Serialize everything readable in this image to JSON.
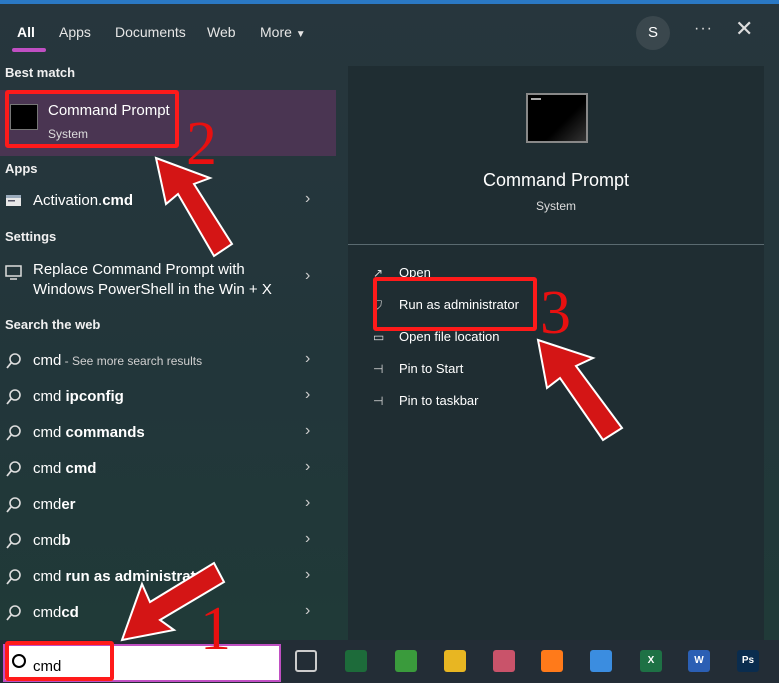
{
  "tabs": [
    {
      "label": "All",
      "active": true
    },
    {
      "label": "Apps"
    },
    {
      "label": "Documents"
    },
    {
      "label": "Web"
    },
    {
      "label": "More"
    }
  ],
  "account_initial": "S",
  "more_options": "···",
  "close_glyph": "✕",
  "sections": {
    "best_match": "Best match",
    "apps": "Apps",
    "settings": "Settings",
    "search_web": "Search the web"
  },
  "best_match": {
    "title": "Command Prompt",
    "subtitle": "System",
    "icon": "cmd-window-icon"
  },
  "apps_items": [
    {
      "name_plain": "Activation.",
      "name_bold": "cmd",
      "icon": "script-file-icon"
    }
  ],
  "settings_items": [
    {
      "line1": "Replace Command Prompt with",
      "line2": "Windows PowerShell in the Win + X",
      "icon": "monitor-icon"
    }
  ],
  "web_items": [
    {
      "plain": "cmd",
      "bold": "",
      "extra": " - See more search results"
    },
    {
      "plain": "cmd ",
      "bold": "ipconfig",
      "extra": ""
    },
    {
      "plain": "cmd ",
      "bold": "commands",
      "extra": ""
    },
    {
      "plain": "cmd ",
      "bold": "cmd",
      "extra": ""
    },
    {
      "plain": "cmd",
      "bold": "er",
      "extra": ""
    },
    {
      "plain": "cmd",
      "bold": "b",
      "extra": ""
    },
    {
      "plain": "cmd ",
      "bold": "run as administrato",
      "extra": ""
    },
    {
      "plain": "cmd",
      "bold": "cd",
      "extra": ""
    }
  ],
  "preview": {
    "title": "Command Prompt",
    "subtitle": "System",
    "actions": [
      {
        "label": "Open",
        "icon": "open-icon"
      },
      {
        "label": "Run as administrator",
        "icon": "shield-icon"
      },
      {
        "label": "Open file location",
        "icon": "folder-icon"
      },
      {
        "label": "Pin to Start",
        "icon": "pin-icon"
      },
      {
        "label": "Pin to taskbar",
        "icon": "pin-icon"
      }
    ]
  },
  "search": {
    "value": "cmd"
  },
  "annotations": {
    "step1": "1",
    "step2": "2",
    "step3": "3",
    "color": "#ff1a1a"
  },
  "taskbar_apps": [
    {
      "name": "task-view-icon",
      "label": "",
      "color": "#232d36"
    },
    {
      "name": "xbox-app-icon",
      "label": "",
      "color": "#1d6b3a"
    },
    {
      "name": "security-lock-icon",
      "label": "",
      "color": "#3a9b3c"
    },
    {
      "name": "file-explorer-icon",
      "label": "",
      "color": "#e8b622"
    },
    {
      "name": "paint-tool-icon",
      "label": "",
      "color": "#c9536a"
    },
    {
      "name": "firefox-icon",
      "label": "",
      "color": "#ff7a1a"
    },
    {
      "name": "store-icon",
      "label": "",
      "color": "#3b8de0"
    },
    {
      "name": "excel-icon",
      "label": "X",
      "color": "#1e7145"
    },
    {
      "name": "word-icon",
      "label": "W",
      "color": "#2b5fb4"
    },
    {
      "name": "photoshop-icon",
      "label": "Ps",
      "color": "#0a2c4e"
    }
  ]
}
